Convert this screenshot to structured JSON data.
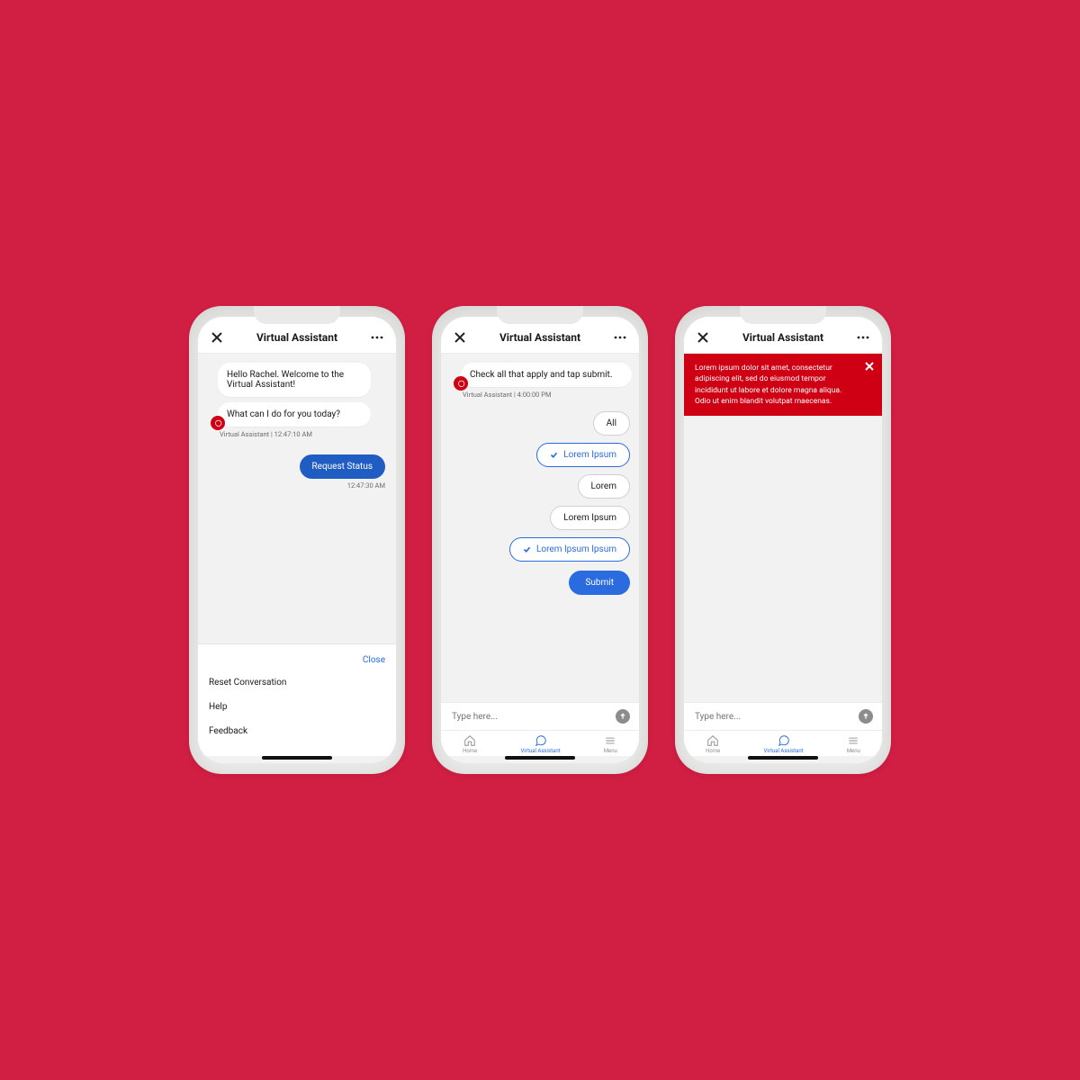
{
  "header": {
    "title": "Virtual Assistant"
  },
  "screen1": {
    "messages": {
      "msg1": "Hello Rachel. Welcome to the Virtual Assistant!",
      "msg2": "What can I do for you today?",
      "meta": "Virtual Assistant | 12:47:10 AM"
    },
    "user": {
      "bubble": "Request Status",
      "meta": "12:47:30 AM"
    },
    "menu": {
      "close": "Close",
      "item1": "Reset Conversation",
      "item2": "Help",
      "item3": "Feedback"
    }
  },
  "screen2": {
    "msg": "Check all that apply and tap submit.",
    "meta": "Virtual Assistant | 4:00:00 PM",
    "chips": {
      "all": "All",
      "c1": "Lorem Ipsum",
      "c2": "Lorem",
      "c3": "Lorem Ipsum",
      "c4": "Lorem Ipsum Ipsum"
    },
    "submit": "Submit",
    "input_placeholder": "Type here..."
  },
  "screen3": {
    "alert": "Lorem ipsum dolor sit amet, consectetur adipiscing elit, sed do eiusmod tempor incididunt ut labore et dolore magna aliqua. Odio ut enim blandit volutpat maecenas.",
    "input_placeholder": "Type here..."
  },
  "tabbar": {
    "home": "Home",
    "va": "Virtual Assistant",
    "menu": "Menu"
  }
}
